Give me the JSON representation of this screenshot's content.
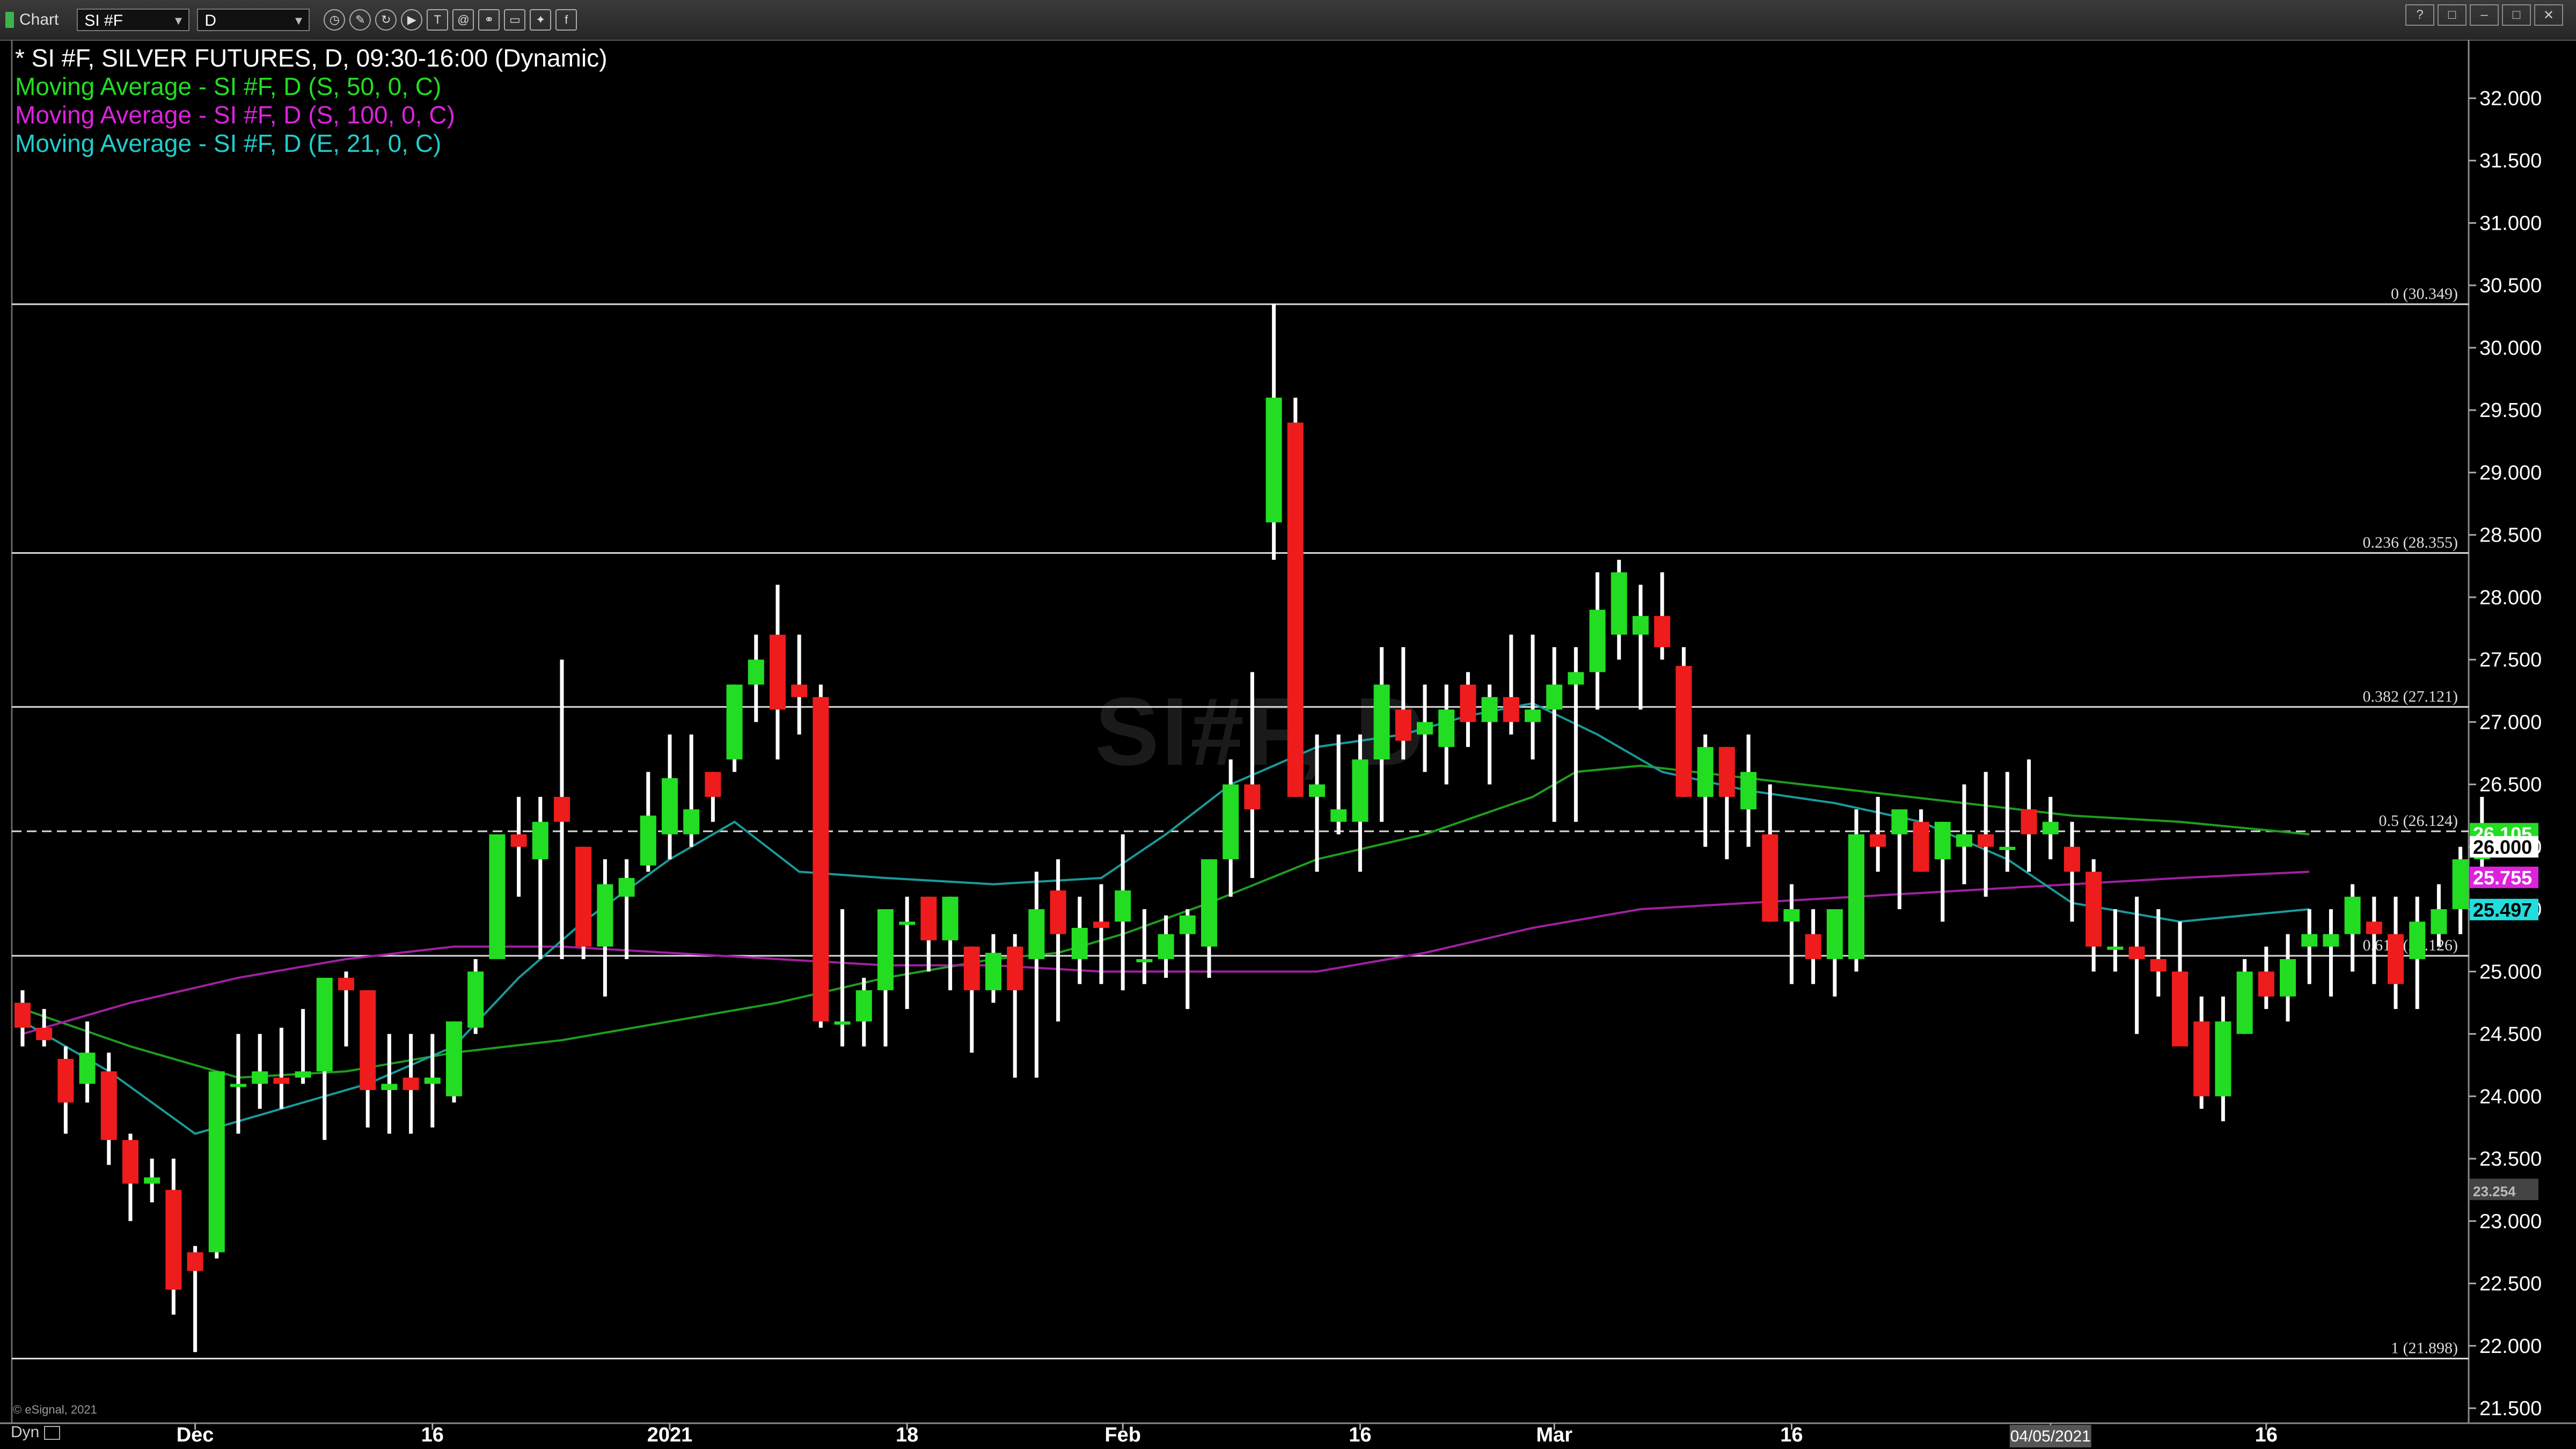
{
  "toolbar": {
    "title": "Chart",
    "symbol": "SI #F",
    "interval": "D",
    "icons": [
      "clock-icon",
      "pencil-icon",
      "cycle-icon",
      "play-icon",
      "text-icon",
      "at-icon",
      "link-icon",
      "window-icon",
      "twitter-icon",
      "facebook-icon"
    ],
    "window_buttons": [
      "?",
      "□",
      "–",
      "□",
      "✕"
    ]
  },
  "legend": [
    {
      "text": "* SI #F, SILVER FUTURES, D, 09:30-16:00 (Dynamic)",
      "color": "#ffffff"
    },
    {
      "text": "Moving Average - SI #F, D (S, 50, 0, C)",
      "color": "#22dd22"
    },
    {
      "text": "Moving Average - SI #F, D (S, 100, 0, C)",
      "color": "#dd22dd"
    },
    {
      "text": "Moving Average - SI #F, D (E, 21, 0, C)",
      "color": "#22cccc"
    }
  ],
  "watermark": "SI#F, D",
  "copyright": "© eSignal, 2021",
  "footer_label": "Dyn",
  "chart_data": {
    "type": "candlestick",
    "y_axis": {
      "min": 21.5,
      "max": 32.0,
      "ticks": [
        "32.000",
        "31.500",
        "31.000",
        "30.500",
        "30.000",
        "29.500",
        "29.000",
        "28.500",
        "28.000",
        "27.500",
        "27.000",
        "26.500",
        "26.000",
        "25.500",
        "25.000",
        "24.500",
        "24.000",
        "23.500",
        "23.000",
        "22.500",
        "22.000",
        "21.500"
      ]
    },
    "x_axis": {
      "labels": [
        {
          "label": "Dec",
          "index": 8
        },
        {
          "label": "16",
          "index": 19
        },
        {
          "label": "2021",
          "index": 30
        },
        {
          "label": "18",
          "index": 41
        },
        {
          "label": "Feb",
          "index": 51
        },
        {
          "label": "16",
          "index": 62
        },
        {
          "label": "Mar",
          "index": 71
        },
        {
          "label": "16",
          "index": 82
        },
        {
          "label": "04/05/2021",
          "index": 94
        },
        {
          "label": "16",
          "index": 104
        }
      ]
    },
    "candles": [
      [
        24.75,
        24.85,
        24.4,
        24.55
      ],
      [
        24.55,
        24.7,
        24.4,
        24.45
      ],
      [
        24.3,
        24.4,
        23.7,
        23.95
      ],
      [
        24.1,
        24.6,
        23.95,
        24.35
      ],
      [
        24.2,
        24.35,
        23.45,
        23.65
      ],
      [
        23.65,
        23.7,
        23.0,
        23.3
      ],
      [
        23.3,
        23.5,
        23.15,
        23.35
      ],
      [
        23.25,
        23.5,
        22.25,
        22.45
      ],
      [
        22.75,
        22.8,
        21.95,
        22.6
      ],
      [
        22.75,
        24.2,
        22.7,
        24.2
      ],
      [
        24.1,
        24.5,
        23.7,
        24.1
      ],
      [
        24.1,
        24.5,
        23.9,
        24.2
      ],
      [
        24.15,
        24.55,
        23.9,
        24.1
      ],
      [
        24.15,
        24.7,
        24.1,
        24.2
      ],
      [
        24.2,
        24.9,
        23.65,
        24.95
      ],
      [
        24.95,
        25.0,
        24.4,
        24.85
      ],
      [
        24.85,
        24.85,
        23.75,
        24.05
      ],
      [
        24.05,
        24.5,
        23.7,
        24.1
      ],
      [
        24.15,
        24.5,
        23.7,
        24.05
      ],
      [
        24.1,
        24.5,
        23.75,
        24.15
      ],
      [
        24.0,
        24.6,
        23.95,
        24.6
      ],
      [
        24.55,
        25.1,
        24.5,
        25.0
      ],
      [
        25.1,
        26.0,
        25.5,
        26.1
      ],
      [
        26.1,
        26.4,
        25.6,
        26.0
      ],
      [
        25.9,
        26.4,
        25.1,
        26.2
      ],
      [
        26.4,
        27.5,
        25.1,
        26.2
      ],
      [
        26.0,
        26.0,
        25.1,
        25.2
      ],
      [
        25.2,
        25.9,
        24.8,
        25.7
      ],
      [
        25.6,
        25.9,
        25.1,
        25.75
      ],
      [
        25.85,
        26.6,
        25.8,
        26.25
      ],
      [
        26.1,
        26.9,
        25.9,
        26.55
      ],
      [
        26.1,
        26.9,
        26.0,
        26.3
      ],
      [
        26.6,
        26.6,
        26.2,
        26.4
      ],
      [
        26.7,
        27.3,
        26.6,
        27.3
      ],
      [
        27.3,
        27.7,
        27.0,
        27.5
      ],
      [
        27.7,
        28.1,
        26.7,
        27.1
      ],
      [
        27.3,
        27.7,
        26.9,
        27.2
      ],
      [
        27.2,
        27.3,
        24.55,
        24.6
      ],
      [
        24.6,
        25.5,
        24.4,
        24.6
      ],
      [
        24.6,
        24.95,
        24.4,
        24.85
      ],
      [
        24.85,
        25.25,
        24.4,
        25.5
      ],
      [
        25.4,
        25.6,
        24.7,
        25.4
      ],
      [
        25.6,
        25.6,
        25.0,
        25.25
      ],
      [
        25.25,
        25.6,
        24.85,
        25.6
      ],
      [
        25.2,
        25.2,
        24.35,
        24.85
      ],
      [
        24.85,
        25.3,
        24.75,
        25.15
      ],
      [
        25.2,
        25.3,
        24.15,
        24.85
      ],
      [
        25.1,
        25.8,
        24.15,
        25.5
      ],
      [
        25.65,
        25.9,
        24.6,
        25.3
      ],
      [
        25.1,
        25.6,
        24.9,
        25.35
      ],
      [
        25.4,
        25.7,
        24.9,
        25.35
      ],
      [
        25.4,
        26.1,
        24.85,
        25.65
      ],
      [
        25.1,
        25.5,
        24.9,
        25.1
      ],
      [
        25.1,
        25.45,
        24.95,
        25.3
      ],
      [
        25.3,
        25.5,
        24.7,
        25.45
      ],
      [
        25.2,
        25.6,
        24.95,
        25.9
      ],
      [
        25.9,
        26.7,
        25.6,
        26.5
      ],
      [
        26.5,
        27.4,
        25.75,
        26.3
      ],
      [
        28.6,
        30.35,
        28.3,
        29.6
      ],
      [
        29.4,
        29.6,
        26.4,
        26.4
      ],
      [
        26.4,
        26.9,
        25.8,
        26.5
      ],
      [
        26.2,
        26.9,
        26.1,
        26.3
      ],
      [
        26.2,
        26.9,
        25.8,
        26.7
      ],
      [
        26.7,
        27.6,
        26.2,
        27.3
      ],
      [
        27.1,
        27.6,
        26.7,
        26.85
      ],
      [
        26.9,
        27.3,
        26.6,
        27.0
      ],
      [
        26.8,
        27.3,
        26.5,
        27.1
      ],
      [
        27.3,
        27.4,
        26.8,
        27.0
      ],
      [
        27.0,
        27.3,
        26.5,
        27.2
      ],
      [
        27.2,
        27.7,
        26.9,
        27.0
      ],
      [
        27.0,
        27.7,
        26.7,
        27.1
      ],
      [
        27.1,
        27.6,
        26.2,
        27.3
      ],
      [
        27.3,
        27.6,
        26.2,
        27.4
      ],
      [
        27.4,
        28.2,
        27.1,
        27.9
      ],
      [
        27.7,
        28.3,
        27.5,
        28.2
      ],
      [
        27.7,
        28.1,
        27.1,
        27.85
      ],
      [
        27.85,
        28.2,
        27.5,
        27.6
      ],
      [
        27.45,
        27.6,
        26.4,
        26.4
      ],
      [
        26.4,
        26.9,
        26.0,
        26.8
      ],
      [
        26.8,
        26.8,
        25.9,
        26.4
      ],
      [
        26.3,
        26.9,
        26.0,
        26.6
      ],
      [
        26.1,
        26.5,
        25.4,
        25.4
      ],
      [
        25.4,
        25.7,
        24.9,
        25.5
      ],
      [
        25.3,
        25.5,
        24.9,
        25.1
      ],
      [
        25.1,
        25.4,
        24.8,
        25.5
      ],
      [
        25.1,
        26.3,
        25.0,
        26.1
      ],
      [
        26.1,
        26.4,
        25.8,
        26.0
      ],
      [
        26.1,
        26.2,
        25.5,
        26.3
      ],
      [
        26.2,
        26.3,
        25.8,
        25.8
      ],
      [
        25.9,
        26.2,
        25.4,
        26.2
      ],
      [
        26.0,
        26.5,
        25.7,
        26.1
      ],
      [
        26.1,
        26.6,
        25.6,
        26.0
      ],
      [
        26.0,
        26.6,
        25.8,
        26.0
      ],
      [
        26.3,
        26.7,
        25.8,
        26.1
      ],
      [
        26.1,
        26.4,
        25.9,
        26.2
      ],
      [
        26.0,
        26.2,
        25.4,
        25.8
      ],
      [
        25.8,
        25.9,
        25.0,
        25.2
      ],
      [
        25.2,
        25.5,
        25.0,
        25.2
      ],
      [
        25.2,
        25.6,
        24.5,
        25.1
      ],
      [
        25.1,
        25.5,
        24.8,
        25.0
      ],
      [
        25.0,
        25.4,
        24.5,
        24.4
      ],
      [
        24.6,
        24.8,
        23.9,
        24.0
      ],
      [
        24.0,
        24.8,
        23.8,
        24.6
      ],
      [
        24.5,
        25.1,
        24.5,
        25.0
      ],
      [
        25.0,
        25.2,
        24.7,
        24.8
      ],
      [
        24.8,
        25.3,
        24.6,
        25.1
      ],
      [
        25.2,
        25.5,
        24.9,
        25.3
      ],
      [
        25.2,
        25.5,
        24.8,
        25.3
      ],
      [
        25.3,
        25.7,
        25.0,
        25.6
      ],
      [
        25.4,
        25.6,
        24.9,
        25.3
      ],
      [
        25.3,
        25.6,
        24.7,
        24.9
      ],
      [
        25.1,
        25.6,
        24.7,
        25.4
      ],
      [
        25.3,
        25.7,
        25.2,
        25.5
      ],
      [
        25.5,
        26.0,
        25.3,
        25.9
      ],
      [
        25.9,
        26.4,
        25.7,
        26.1
      ]
    ],
    "moving_averages": [
      {
        "name": "Moving Average - SI #F, D (S, 50, 0, C)",
        "color": "#1e9e1e",
        "values": [
          [
            0,
            24.7
          ],
          [
            5,
            24.4
          ],
          [
            10,
            24.15
          ],
          [
            15,
            24.2
          ],
          [
            20,
            24.35
          ],
          [
            25,
            24.45
          ],
          [
            30,
            24.6
          ],
          [
            35,
            24.75
          ],
          [
            40,
            24.95
          ],
          [
            45,
            25.1
          ],
          [
            48,
            25.15
          ],
          [
            51,
            25.3
          ],
          [
            55,
            25.55
          ],
          [
            60,
            25.9
          ],
          [
            65,
            26.1
          ],
          [
            70,
            26.4
          ],
          [
            72,
            26.6
          ],
          [
            75,
            26.65
          ],
          [
            80,
            26.55
          ],
          [
            85,
            26.45
          ],
          [
            90,
            26.35
          ],
          [
            95,
            26.25
          ],
          [
            100,
            26.2
          ],
          [
            106,
            26.1
          ]
        ]
      },
      {
        "name": "Moving Average - SI #F, D (S, 100, 0, C)",
        "color": "#a020a0",
        "values": [
          [
            0,
            24.5
          ],
          [
            5,
            24.75
          ],
          [
            10,
            24.95
          ],
          [
            15,
            25.1
          ],
          [
            20,
            25.2
          ],
          [
            25,
            25.2
          ],
          [
            30,
            25.15
          ],
          [
            35,
            25.1
          ],
          [
            40,
            25.05
          ],
          [
            45,
            25.05
          ],
          [
            50,
            25.0
          ],
          [
            55,
            25.0
          ],
          [
            60,
            25.0
          ],
          [
            65,
            25.15
          ],
          [
            70,
            25.35
          ],
          [
            75,
            25.5
          ],
          [
            80,
            25.55
          ],
          [
            85,
            25.6
          ],
          [
            90,
            25.65
          ],
          [
            95,
            25.7
          ],
          [
            100,
            25.75
          ],
          [
            106,
            25.8
          ]
        ]
      },
      {
        "name": "Moving Average - SI #F, D (E, 21, 0, C)",
        "color": "#1a9a9a",
        "values": [
          [
            0,
            24.6
          ],
          [
            4,
            24.2
          ],
          [
            8,
            23.7
          ],
          [
            12,
            23.9
          ],
          [
            16,
            24.1
          ],
          [
            20,
            24.4
          ],
          [
            23,
            24.95
          ],
          [
            26,
            25.4
          ],
          [
            30,
            25.9
          ],
          [
            33,
            26.2
          ],
          [
            36,
            25.8
          ],
          [
            40,
            25.75
          ],
          [
            45,
            25.7
          ],
          [
            50,
            25.75
          ],
          [
            53,
            26.1
          ],
          [
            56,
            26.5
          ],
          [
            60,
            26.8
          ],
          [
            64,
            26.9
          ],
          [
            67,
            27.05
          ],
          [
            70,
            27.15
          ],
          [
            73,
            26.9
          ],
          [
            76,
            26.6
          ],
          [
            80,
            26.45
          ],
          [
            84,
            26.35
          ],
          [
            88,
            26.2
          ],
          [
            92,
            25.9
          ],
          [
            95,
            25.55
          ],
          [
            100,
            25.4
          ],
          [
            106,
            25.5
          ]
        ]
      }
    ],
    "fibonacci_levels": [
      {
        "label": "0 (30.349)",
        "value": 30.349
      },
      {
        "label": "0.236 (28.355)",
        "value": 28.355
      },
      {
        "label": "0.382 (27.121)",
        "value": 27.121
      },
      {
        "label": "0.5 (26.124)",
        "value": 26.124
      },
      {
        "label": "0.618 (25.126)",
        "value": 25.126
      },
      {
        "label": "1 (21.898)",
        "value": 21.898
      }
    ],
    "price_tags": [
      {
        "label": "26.105",
        "value": 26.105,
        "color": "#22dd22",
        "text_color": "#ffffff"
      },
      {
        "label": "26.000",
        "value": 26.0,
        "color": "#ffffff",
        "text_color": "#000000"
      },
      {
        "label": "25.755",
        "value": 25.755,
        "color": "#dd22dd",
        "text_color": "#ffffff"
      },
      {
        "label": "25.497",
        "value": 25.497,
        "color": "#22dddd",
        "text_color": "#000000"
      },
      {
        "label": "23.254",
        "value": 23.254,
        "color": "#444444",
        "text_color": "#bbbbbb"
      }
    ],
    "colors": {
      "up": "#22dd22",
      "down": "#ee1c1c",
      "wick": "#ffffff",
      "background": "#000000",
      "fib_line": "#dddddd"
    }
  }
}
